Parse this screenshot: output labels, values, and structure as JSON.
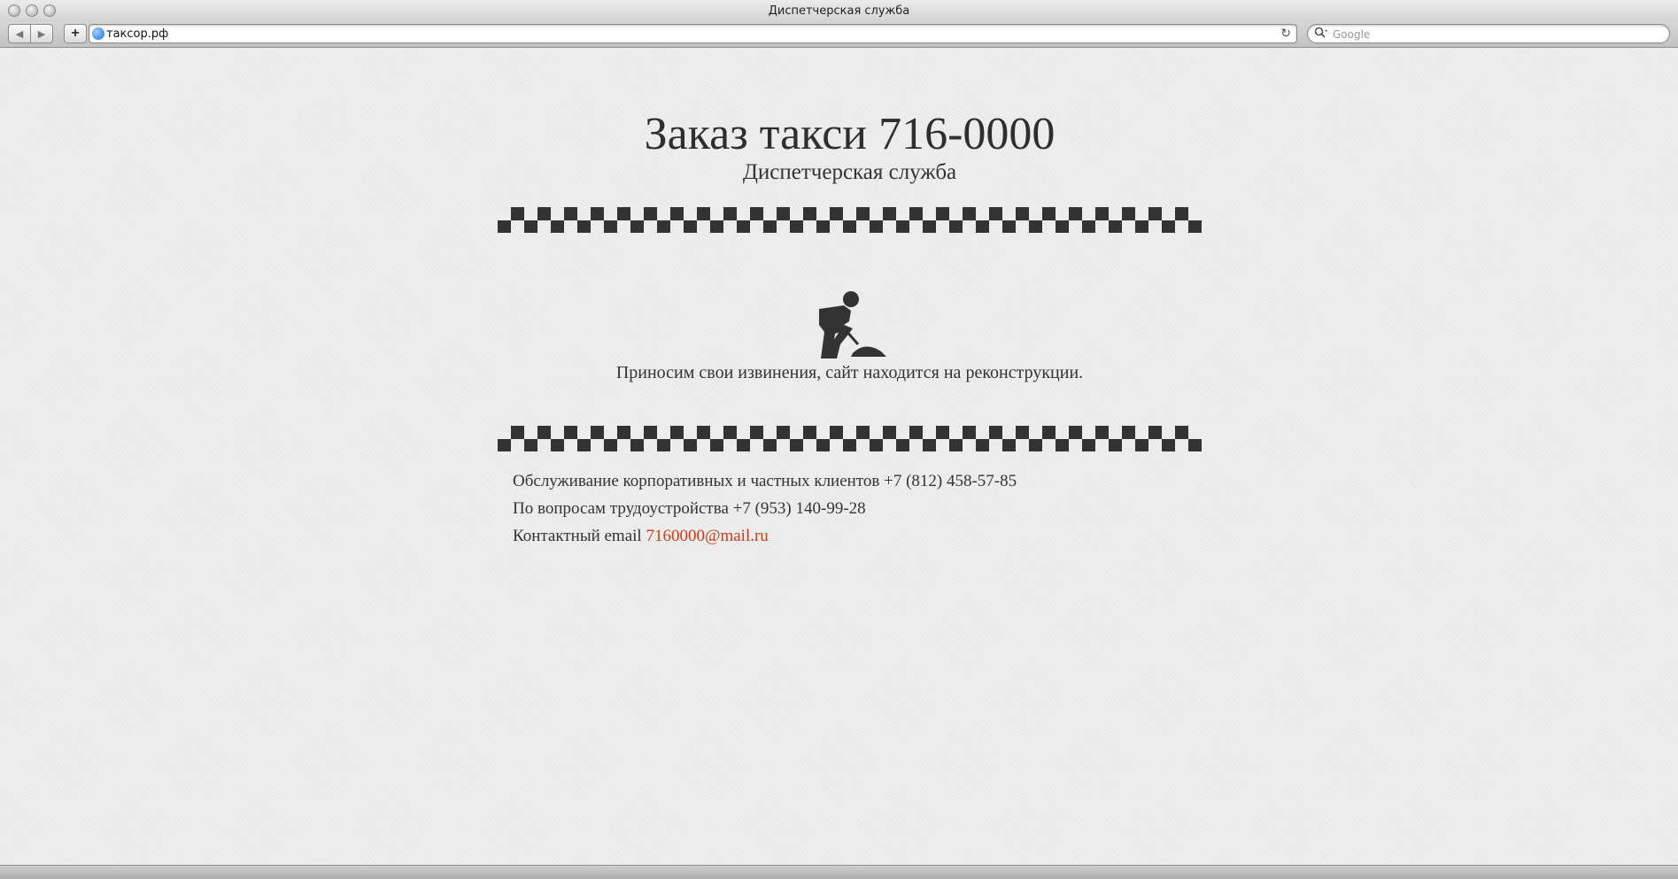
{
  "window": {
    "title": "Диспетчерская служба"
  },
  "toolbar": {
    "back_glyph": "◀",
    "forward_glyph": "▶",
    "add_glyph": "+",
    "url": "таксор.рф",
    "reload_glyph": "↻",
    "search_placeholder": "Google"
  },
  "page": {
    "headline": "Заказ такси 716-0000",
    "subheadline": "Диспетчерская служба",
    "apology": "Приносим свои извинения, сайт находится на реконструкции.",
    "contacts": {
      "corporate_label": "Обслуживание корпоративных и частных клиентов",
      "corporate_phone": "+7 (812) 458-57-85",
      "jobs_label": "По вопросам трудоустройства",
      "jobs_phone": "+7 (953) 140-99-28",
      "email_label": "Контактный email",
      "email": "7160000@mail.ru"
    }
  },
  "icons": {
    "worker": "construction-worker-icon",
    "checker": "taxi-checker-strip"
  },
  "colors": {
    "link": "#d23a12",
    "text": "#2b2b2b",
    "background": "#efefef"
  }
}
